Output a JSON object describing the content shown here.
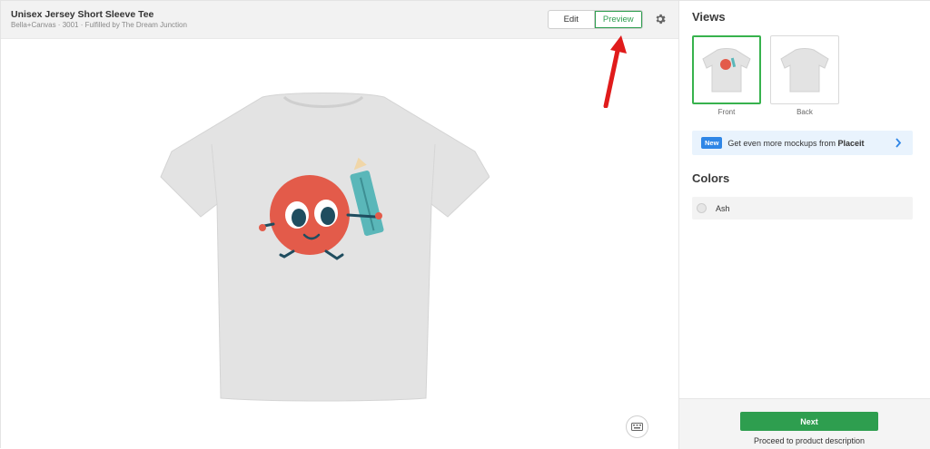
{
  "product": {
    "title": "Unisex Jersey Short Sleeve Tee",
    "subtitle": "Bella+Canvas · 3001 · Fulfilled by The Dream Junction"
  },
  "mode_toggle": {
    "edit_label": "Edit",
    "preview_label": "Preview",
    "selected": "Preview"
  },
  "toolbar": {
    "settings_icon": "gear-icon",
    "keyboard_icon": "keyboard-icon"
  },
  "annotation": {
    "arrow_color": "#e01b1b",
    "arrow_icon": "arrow-up-icon"
  },
  "preview": {
    "shirt_color": "#e3e3e3",
    "design_colors": [
      "#e35b4a",
      "#1f4d5f",
      "#5ab7b9"
    ]
  },
  "views": {
    "title": "Views",
    "items": [
      {
        "label": "Front",
        "selected": true
      },
      {
        "label": "Back",
        "selected": false
      }
    ]
  },
  "promo": {
    "badge": "New",
    "text": "Get even more mockups from",
    "brand": "Placeit",
    "icon": "chevron-right-icon"
  },
  "colors": {
    "title": "Colors",
    "items": [
      {
        "name": "Ash",
        "swatch": "#e6e6e6"
      }
    ]
  },
  "footer": {
    "next_label": "Next",
    "next_sub": "Proceed to product description"
  },
  "theme": {
    "accent": "#2e9e4f",
    "promo_badge": "#2f86e6"
  }
}
